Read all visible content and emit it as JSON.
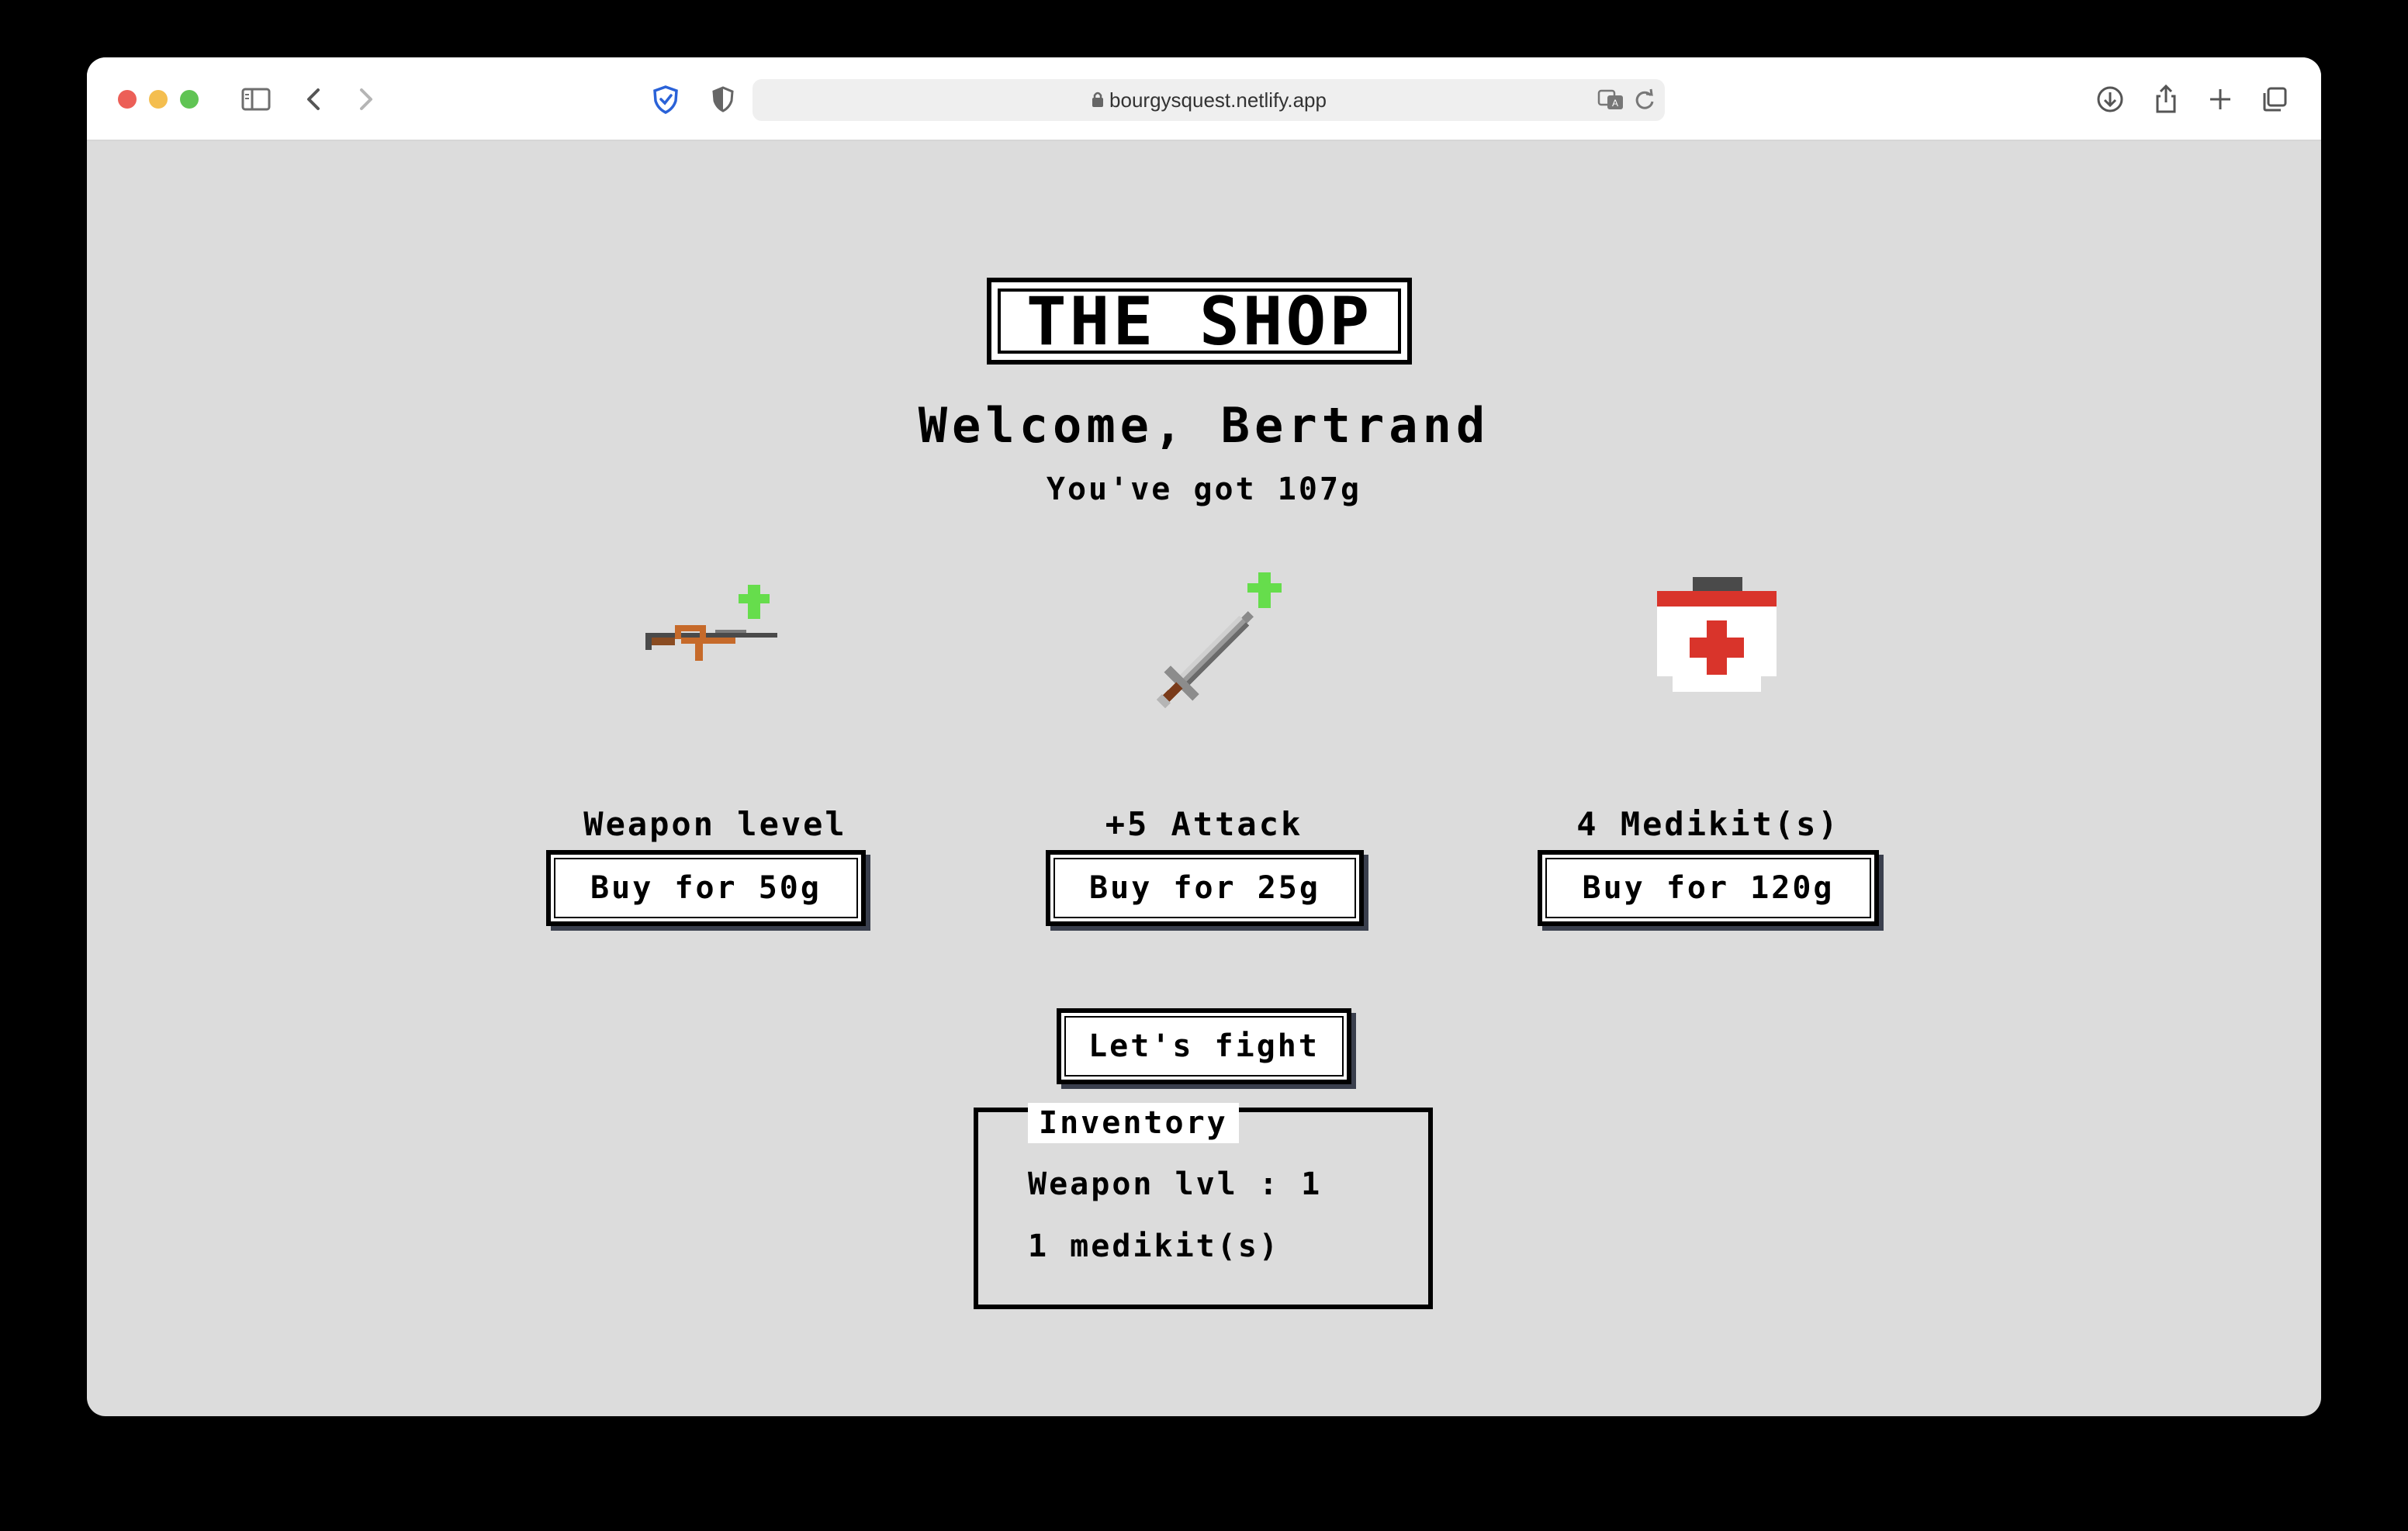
{
  "browser": {
    "url": "bourgysquest.netlify.app"
  },
  "page": {
    "title": "THE SHOP",
    "welcome": "Welcome, Bertrand",
    "gold": "You've got 107g",
    "items": [
      {
        "label": "Weapon level",
        "button": "Buy for 50g",
        "icon": "rifle-upgrade-icon"
      },
      {
        "label": "+5 Attack",
        "button": "Buy for 25g",
        "icon": "sword-upgrade-icon"
      },
      {
        "label": "4 Medikit(s)",
        "button": "Buy for 120g",
        "icon": "medikit-icon"
      }
    ],
    "fight_button": "Let's fight",
    "inventory": {
      "title": "Inventory",
      "lines": [
        "Weapon lvl : 1",
        "1 medikit(s)"
      ]
    }
  },
  "colors": {
    "page_bg": "#dcdcdc",
    "button_shadow": "#3a3f4d",
    "upgrade_arrow": "#66dd4c",
    "medikit_red": "#d9342b"
  }
}
